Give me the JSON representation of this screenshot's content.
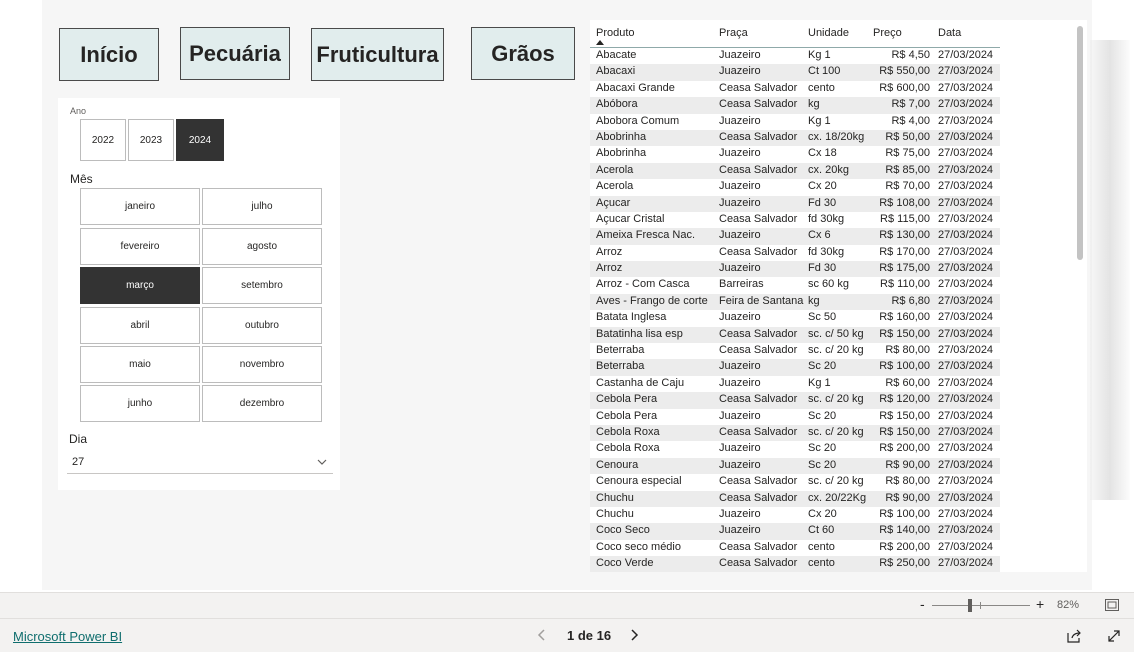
{
  "nav": {
    "inicio": "Início",
    "pecuaria": "Pecuária",
    "fruticultura": "Fruticultura",
    "graos": "Grãos"
  },
  "filters": {
    "ano_label": "Ano",
    "anos": [
      "2022",
      "2023",
      "2024"
    ],
    "ano_selected": "2024",
    "mes_label": "Mês",
    "meses": [
      "janeiro",
      "julho",
      "fevereiro",
      "agosto",
      "março",
      "setembro",
      "abril",
      "outubro",
      "maio",
      "novembro",
      "junho",
      "dezembro"
    ],
    "mes_selected": "março",
    "dia_label": "Dia",
    "dia_value": "27"
  },
  "table": {
    "headers": [
      "Produto",
      "Praça",
      "Unidade",
      "Preço",
      "Data"
    ],
    "rows": [
      [
        "Abacate",
        "Juazeiro",
        "Kg 1",
        "R$ 4,50",
        "27/03/2024"
      ],
      [
        "Abacaxi",
        "Juazeiro",
        "Ct 100",
        "R$ 550,00",
        "27/03/2024"
      ],
      [
        "Abacaxi Grande",
        "Ceasa Salvador",
        "cento",
        "R$ 600,00",
        "27/03/2024"
      ],
      [
        "Abóbora",
        "Ceasa Salvador",
        "kg",
        "R$ 7,00",
        "27/03/2024"
      ],
      [
        "Abobora Comum",
        "Juazeiro",
        "Kg 1",
        "R$ 4,00",
        "27/03/2024"
      ],
      [
        "Abobrinha",
        "Ceasa Salvador",
        "cx. 18/20kg",
        "R$ 50,00",
        "27/03/2024"
      ],
      [
        "Abobrinha",
        "Juazeiro",
        "Cx 18",
        "R$ 75,00",
        "27/03/2024"
      ],
      [
        "Acerola",
        "Ceasa Salvador",
        "cx. 20kg",
        "R$ 85,00",
        "27/03/2024"
      ],
      [
        "Acerola",
        "Juazeiro",
        "Cx 20",
        "R$ 70,00",
        "27/03/2024"
      ],
      [
        "Açucar",
        "Juazeiro",
        "Fd 30",
        "R$ 108,00",
        "27/03/2024"
      ],
      [
        "Açucar Cristal",
        "Ceasa Salvador",
        "fd 30kg",
        "R$ 115,00",
        "27/03/2024"
      ],
      [
        "Ameixa Fresca Nac.",
        "Juazeiro",
        "Cx 6",
        "R$ 130,00",
        "27/03/2024"
      ],
      [
        "Arroz",
        "Ceasa Salvador",
        "fd 30kg",
        "R$ 170,00",
        "27/03/2024"
      ],
      [
        "Arroz",
        "Juazeiro",
        "Fd 30",
        "R$ 175,00",
        "27/03/2024"
      ],
      [
        "Arroz - Com Casca",
        "Barreiras",
        "sc 60 kg",
        "R$ 110,00",
        "27/03/2024"
      ],
      [
        "Aves - Frango de corte",
        "Feira de Santana",
        "kg",
        "R$ 6,80",
        "27/03/2024"
      ],
      [
        "Batata Inglesa",
        "Juazeiro",
        "Sc 50",
        "R$ 160,00",
        "27/03/2024"
      ],
      [
        "Batatinha lisa esp",
        "Ceasa Salvador",
        "sc. c/ 50 kg",
        "R$ 150,00",
        "27/03/2024"
      ],
      [
        "Beterraba",
        "Ceasa Salvador",
        "sc. c/ 20 kg",
        "R$ 80,00",
        "27/03/2024"
      ],
      [
        "Beterraba",
        "Juazeiro",
        "Sc 20",
        "R$ 100,00",
        "27/03/2024"
      ],
      [
        "Castanha de Caju",
        "Juazeiro",
        "Kg 1",
        "R$ 60,00",
        "27/03/2024"
      ],
      [
        "Cebola Pera",
        "Ceasa Salvador",
        "sc. c/ 20 kg",
        "R$ 120,00",
        "27/03/2024"
      ],
      [
        "Cebola Pera",
        "Juazeiro",
        "Sc 20",
        "R$ 150,00",
        "27/03/2024"
      ],
      [
        "Cebola Roxa",
        "Ceasa Salvador",
        "sc. c/ 20 kg",
        "R$ 150,00",
        "27/03/2024"
      ],
      [
        "Cebola Roxa",
        "Juazeiro",
        "Sc 20",
        "R$ 200,00",
        "27/03/2024"
      ],
      [
        "Cenoura",
        "Juazeiro",
        "Sc 20",
        "R$ 90,00",
        "27/03/2024"
      ],
      [
        "Cenoura especial",
        "Ceasa Salvador",
        "sc. c/ 20 kg",
        "R$ 80,00",
        "27/03/2024"
      ],
      [
        "Chuchu",
        "Ceasa Salvador",
        "cx. 20/22Kg",
        "R$ 90,00",
        "27/03/2024"
      ],
      [
        "Chuchu",
        "Juazeiro",
        "Cx 20",
        "R$ 100,00",
        "27/03/2024"
      ],
      [
        "Coco Seco",
        "Juazeiro",
        "Ct 60",
        "R$ 140,00",
        "27/03/2024"
      ],
      [
        "Coco seco médio",
        "Ceasa Salvador",
        "cento",
        "R$ 200,00",
        "27/03/2024"
      ],
      [
        "Coco Verde",
        "Ceasa Salvador",
        "cento",
        "R$ 250,00",
        "27/03/2024"
      ]
    ]
  },
  "zoom": {
    "minus": "-",
    "plus": "+",
    "percent": "82%"
  },
  "footer": {
    "brand": "Microsoft Power BI",
    "page_indicator": "1 de 16"
  }
}
